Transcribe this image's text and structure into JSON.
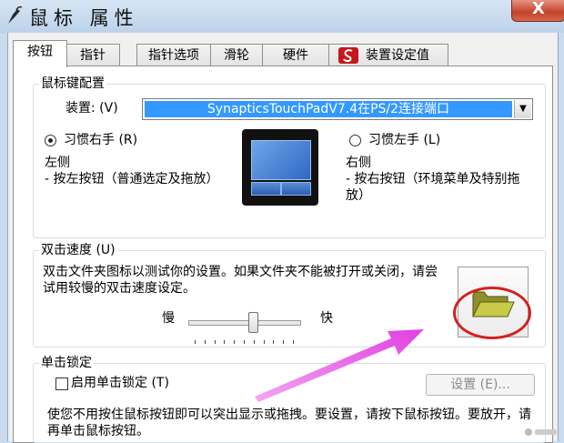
{
  "window": {
    "title": "鼠标 属性",
    "close_label": "X"
  },
  "tabs": [
    {
      "label": "按钮",
      "active": true
    },
    {
      "label": "指针"
    },
    {
      "label": "指针选项"
    },
    {
      "label": "滑轮"
    },
    {
      "label": "硬件"
    },
    {
      "label": "装置设定值"
    }
  ],
  "button_config": {
    "group_label": "鼠标键配置",
    "device_label": "装置: (V)",
    "device_value": "SynapticsTouchPadV7.4在PS/2连接端口",
    "right_hand_label": "习惯右手 (R)",
    "right_hand_selected": true,
    "left_hand_label": "习惯左手 (L)",
    "left_hand_selected": false,
    "left_side_title": "左侧",
    "left_side_desc": "- 按左按钮（普通选定及拖放）",
    "right_side_title": "右侧",
    "right_side_desc": "- 按右按钮（环境菜单及特别拖放）"
  },
  "double_click": {
    "group_label": "双击速度 (U)",
    "description": "双击文件夹图标以测试你的设置。如果文件夹不能被打开或关闭，请尝试用较慢的双击速度设定。",
    "slow_label": "慢",
    "fast_label": "快",
    "speed": 0.58
  },
  "click_lock": {
    "group_label": "单击锁定",
    "checkbox_label": "启用单击锁定 (T)",
    "checked": false,
    "settings_button_label": "设置 (E)...",
    "description": "使您不用按住鼠标按钮即可以突出显示或拖拽。要设置，请按下鼠标按钮。要放开，请再单击鼠标按钮。"
  },
  "colors": {
    "selection": "#3399ff",
    "annotation_circle": "#d42020",
    "annotation_arrow": "#e040e0"
  }
}
